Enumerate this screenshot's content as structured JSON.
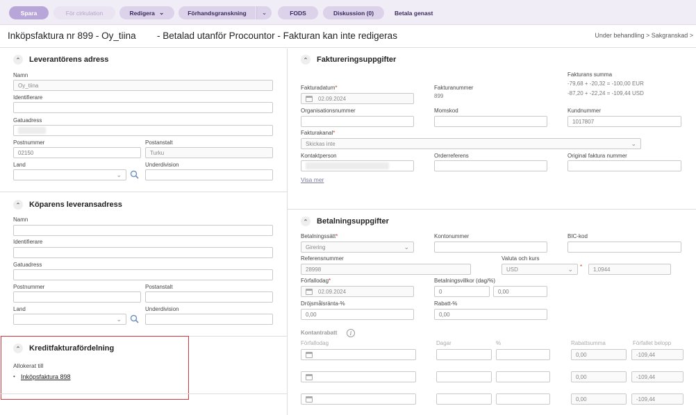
{
  "toolbar": {
    "save": "Spara",
    "circulate": "För cirkulation",
    "edit": "Redigera",
    "preview": "Förhandsgranskning",
    "fods": "FODS",
    "discussion": "Diskussion (0)",
    "pay_now": "Betala genast"
  },
  "header": {
    "title": "Inköpsfaktura nr 899 - Oy_tiina",
    "status": "- Betalad utanför Procountor - Fakturan kan inte redigeras",
    "breadcrumb": "Under behandling >  Sakgranskad >"
  },
  "supplier": {
    "heading": "Leverantörens adress",
    "name_label": "Namn",
    "name_placeholder": "Oy_tiina",
    "identifier_label": "Identifierare",
    "street_label": "Gatuadress",
    "postal_label": "Postnummer",
    "postal_value": "02150",
    "city_label": "Postanstalt",
    "city_value": "Turku",
    "country_label": "Land",
    "subdivision_label": "Underdivision"
  },
  "buyer": {
    "heading": "Köparens leveransadress",
    "name_label": "Namn",
    "identifier_label": "Identifierare",
    "street_label": "Gatuadress",
    "postal_label": "Postnummer",
    "city_label": "Postanstalt",
    "country_label": "Land",
    "subdivision_label": "Underdivision"
  },
  "credit": {
    "heading": "Kreditfakturafördelning",
    "allocated_label": "Allokerat till",
    "bullet": "•",
    "link": "Inköpsfaktura 898"
  },
  "invoicing": {
    "heading": "Faktureringsuppgifter",
    "invoice_date_label": "Fakturadatum",
    "invoice_date": "02.09.2024",
    "invoice_number_label": "Fakturanummer",
    "invoice_number": "899",
    "sum_label": "Fakturans summa",
    "sum_line1": "-79,68 + -20,32 = -100,00 EUR",
    "sum_line2": "-87,20 + -22,24 = -109,44 USD",
    "org_label": "Organisationsnummer",
    "vat_label": "Momskod",
    "customer_number_label": "Kundnummer",
    "customer_number": "1017807",
    "channel_label": "Fakturakanal",
    "channel_value": "Skickas inte",
    "contact_label": "Kontaktperson",
    "order_ref_label": "Orderreferens",
    "original_label": "Original faktura nummer",
    "show_more": "Visa mer"
  },
  "payment": {
    "heading": "Betalningsuppgifter",
    "method_label": "Betalningssätt",
    "method_value": "Girering",
    "account_label": "Kontonummer",
    "bic_label": "BIC-kod",
    "ref_label": "Referensnummer",
    "ref_value": "28998",
    "currency_label": "Valuta och kurs",
    "currency_value": "USD",
    "rate_value": "1,0944",
    "due_label": "Förfallodag",
    "due_value": "02.09.2024",
    "terms_label": "Betalningsvillkor (dag/%)",
    "terms_days": "0",
    "terms_pct": "0,00",
    "interest_label": "Dröjsmålsränta-%",
    "interest_value": "0,00",
    "discount_label": "Rabatt-%",
    "discount_value": "0,00",
    "cash_discount_heading": "Kontantrabatt",
    "cd_cols": [
      "Förfallodag",
      "Dagar",
      "%",
      "Rabattsumma",
      "Förfallet belopp"
    ],
    "cd_rows": [
      {
        "amount": "0,00",
        "due_amount": "-109,44"
      },
      {
        "amount": "0,00",
        "due_amount": "-109,44"
      },
      {
        "amount": "0,00",
        "due_amount": "-109,44"
      }
    ]
  }
}
